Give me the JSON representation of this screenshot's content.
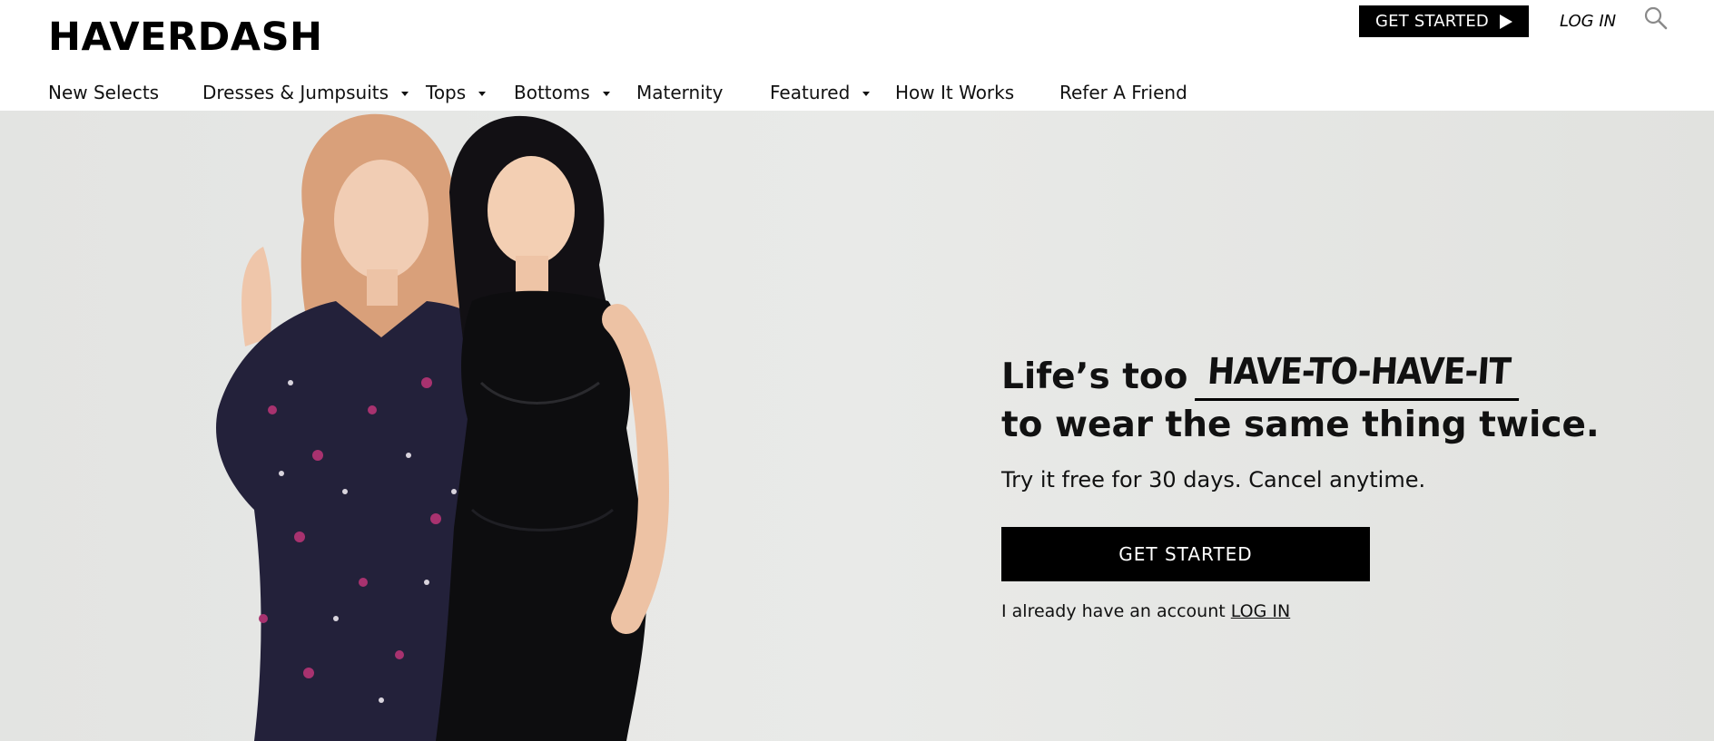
{
  "brand": {
    "logo_text": "HAVERDASH"
  },
  "header": {
    "cta_label": "GET STARTED",
    "login_label": "LOG IN",
    "search_icon": "search-icon"
  },
  "nav": {
    "items": [
      {
        "label": "New Selects",
        "has_dropdown": false
      },
      {
        "label": "Dresses & Jumpsuits",
        "has_dropdown": true
      },
      {
        "label": "Tops",
        "has_dropdown": true
      },
      {
        "label": "Bottoms",
        "has_dropdown": true
      },
      {
        "label": "Maternity",
        "has_dropdown": false
      },
      {
        "label": "Featured",
        "has_dropdown": true
      },
      {
        "label": "How It Works",
        "has_dropdown": false
      },
      {
        "label": "Refer A Friend",
        "has_dropdown": false
      }
    ]
  },
  "hero": {
    "headline_prefix": "Life’s too",
    "headline_emphasis": "HAVE-TO-HAVE-IT",
    "headline_line2": "to wear the same thing twice.",
    "subheadline": "Try it free for 30 days. Cancel anytime.",
    "cta_label": "GET STARTED",
    "account_text": "I already have an account",
    "account_link": "LOG IN"
  },
  "colors": {
    "primary": "#000000",
    "hero_background": "#e6e7e5",
    "text": "#111111"
  }
}
